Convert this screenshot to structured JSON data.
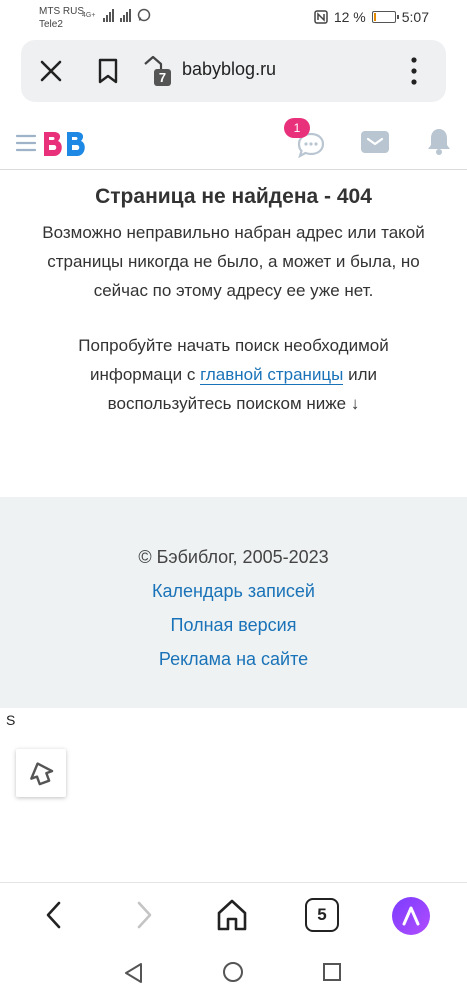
{
  "status_bar": {
    "carrier1": "MTS RUS",
    "carrier2": "Tele2",
    "network": "4G+",
    "battery": "12 %",
    "battery_level": 0.12,
    "time": "5:07"
  },
  "browser": {
    "url": "babyblog.ru",
    "shield_count": "7"
  },
  "site_header": {
    "chat_badge": "1"
  },
  "main": {
    "title": "Страница не найдена - 404",
    "description": "Возможно неправильно набран адрес или такой страницы никогда не было, а может и была, но сейчас по этому адресу ее уже нет.",
    "suggest_before": "Попробуйте начать поиск необходимой информаци с ",
    "suggest_link": "главной страницы",
    "suggest_after": " или воспользуйтесь поиском ниже ↓"
  },
  "footer": {
    "copyright": "© Бэбиблог, 2005-2023",
    "links": [
      "Календарь записей",
      "Полная версия",
      "Реклама на сайте"
    ]
  },
  "stray_text": "S",
  "bottom_nav": {
    "tabs_count": "5"
  },
  "colors": {
    "link": "#1a73b8",
    "badge": "#e8317a",
    "logo_pink": "#e8317a",
    "logo_blue": "#1e88e5",
    "footer_bg": "#eef2f3",
    "alice": "#8a3dff"
  }
}
